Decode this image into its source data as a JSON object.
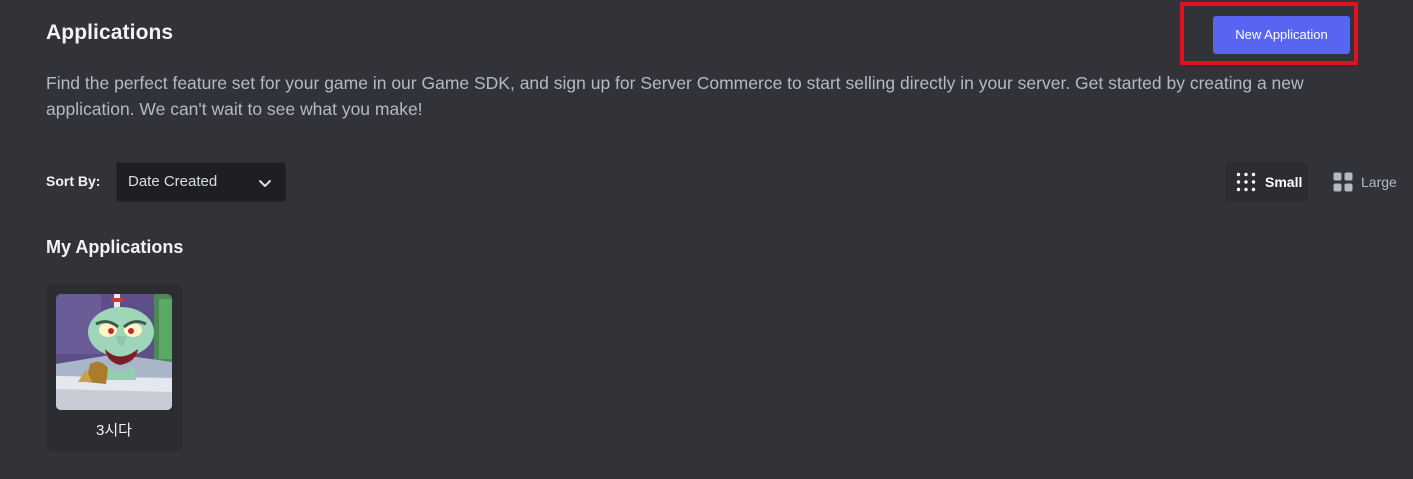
{
  "header": {
    "title": "Applications",
    "new_app_label": "New Application"
  },
  "intro": {
    "description": "Find the perfect feature set for your game in our Game SDK, and sign up for Server Commerce to start selling directly in your server. Get started by creating a new application. We can't wait to see what you make!"
  },
  "sort": {
    "label": "Sort By:",
    "selected": "Date Created"
  },
  "view_toggle": {
    "small_label": "Small",
    "large_label": "Large",
    "active": "small"
  },
  "my_apps": {
    "title": "My Applications",
    "items": [
      {
        "name": "3시다",
        "icon": "squidward-avatar"
      }
    ]
  },
  "colors": {
    "background": "#313338",
    "accent": "#5865f2",
    "highlight": "#e0101e",
    "card": "#2b2d31",
    "input": "#1e1f22"
  },
  "icons": {
    "dropdown": "chevron-down-icon",
    "small_view": "small-grid-icon",
    "large_view": "large-grid-icon"
  }
}
